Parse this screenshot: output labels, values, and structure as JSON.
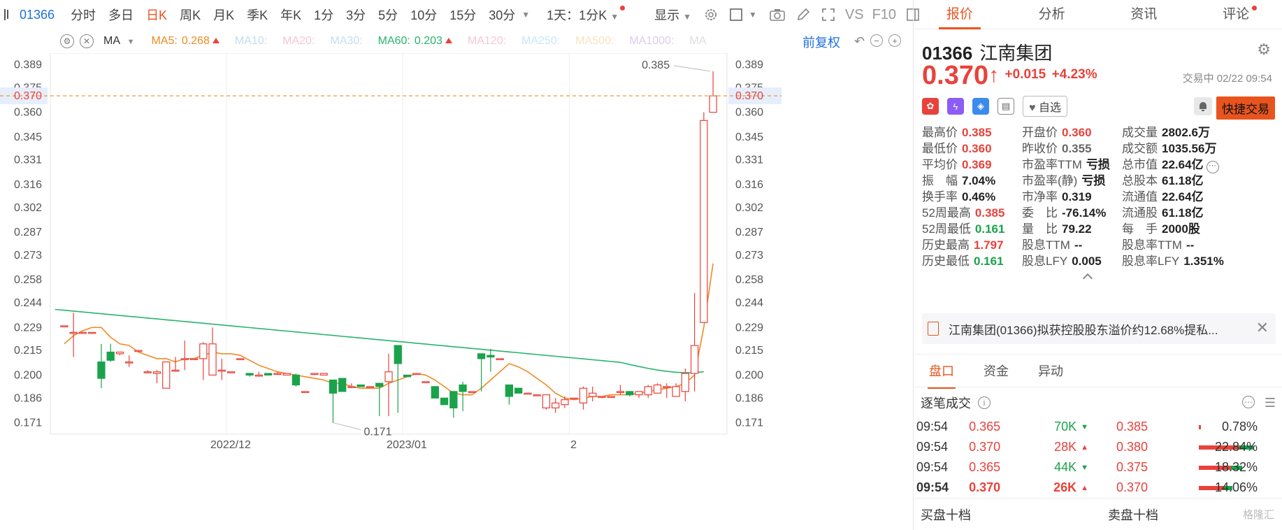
{
  "toolbar": {
    "code": "01366",
    "periods": [
      "分时",
      "多日",
      "日K",
      "周K",
      "月K",
      "季K",
      "年K",
      "1分",
      "3分",
      "5分",
      "10分",
      "15分",
      "30分"
    ],
    "active_period": "日K",
    "multi_select": "1天：1分K",
    "display": "显示",
    "vs": "VS",
    "f10": "F10"
  },
  "ma": {
    "selector": "MA",
    "items": [
      {
        "label": "MA5:",
        "value": "0.268",
        "color": "#f08a24",
        "arrow": true
      },
      {
        "label": "MA10:",
        "value": "",
        "color": "#c4dcf2",
        "arrow": false
      },
      {
        "label": "MA20:",
        "value": "",
        "color": "#f6c6d8",
        "arrow": false
      },
      {
        "label": "MA30:",
        "value": "",
        "color": "#c4dcf2",
        "arrow": false
      },
      {
        "label": "MA60:",
        "value": "0.203",
        "color": "#28b46e",
        "arrow": true
      },
      {
        "label": "MA120:",
        "value": "",
        "color": "#f6c6d8",
        "arrow": false
      },
      {
        "label": "MA250:",
        "value": "",
        "color": "#c8e8f6",
        "arrow": false
      },
      {
        "label": "MA500:",
        "value": "",
        "color": "#f7e2c0",
        "arrow": false
      },
      {
        "label": "MA1000:",
        "value": "",
        "color": "#dccbf0",
        "arrow": false
      },
      {
        "label": "MA",
        "value": "",
        "color": "#dddddd",
        "arrow": false
      }
    ],
    "adjust": "前复权"
  },
  "chart_data": {
    "type": "candlestick",
    "y_ticks": [
      "0.389",
      "0.375",
      "0.360",
      "0.345",
      "0.331",
      "0.316",
      "0.302",
      "0.287",
      "0.273",
      "0.258",
      "0.244",
      "0.229",
      "0.215",
      "0.200",
      "0.186",
      "0.171"
    ],
    "ylim": [
      0.164,
      0.396
    ],
    "x_labels": [
      {
        "label": "2022/12",
        "index": 18
      },
      {
        "label": "2023/01",
        "index": 37
      },
      {
        "label": "2",
        "index": 55
      }
    ],
    "current_price": "0.370",
    "max_label": "0.385",
    "min_label": "0.171",
    "candles": [
      [
        0.23,
        0.23,
        0.23,
        0.23
      ],
      [
        0.226,
        0.238,
        0.211,
        0.226
      ],
      [
        0.226,
        0.226,
        0.226,
        0.226
      ],
      [
        0.226,
        0.226,
        0.225,
        0.226
      ],
      [
        0.208,
        0.219,
        0.192,
        0.198
      ],
      [
        0.214,
        0.219,
        0.208,
        0.209
      ],
      [
        0.213,
        0.214,
        0.212,
        0.214
      ],
      [
        0.208,
        0.212,
        0.205,
        0.208
      ],
      [
        0.215,
        0.215,
        0.215,
        0.215
      ],
      [
        0.202,
        0.203,
        0.201,
        0.202
      ],
      [
        0.201,
        0.203,
        0.195,
        0.202
      ],
      [
        0.192,
        0.208,
        0.192,
        0.208
      ],
      [
        0.203,
        0.211,
        0.202,
        0.203
      ],
      [
        0.21,
        0.221,
        0.203,
        0.21
      ],
      [
        0.21,
        0.21,
        0.21,
        0.21
      ],
      [
        0.21,
        0.22,
        0.197,
        0.219
      ],
      [
        0.2,
        0.229,
        0.2,
        0.219
      ],
      [
        0.203,
        0.21,
        0.197,
        0.203
      ],
      [
        0.202,
        0.202,
        0.202,
        0.202
      ],
      [
        0.21,
        0.21,
        0.21,
        0.21
      ],
      [
        0.201,
        0.201,
        0.199,
        0.2
      ],
      [
        0.2,
        0.202,
        0.199,
        0.2
      ],
      [
        0.201,
        0.201,
        0.2,
        0.2
      ],
      [
        0.201,
        0.202,
        0.201,
        0.201
      ],
      [
        0.2,
        0.201,
        0.2,
        0.201
      ],
      [
        0.2,
        0.201,
        0.193,
        0.194
      ],
      [
        0.19,
        0.19,
        0.19,
        0.19
      ],
      [
        0.201,
        0.201,
        0.2,
        0.201
      ],
      [
        0.2,
        0.201,
        0.2,
        0.201
      ],
      [
        0.197,
        0.197,
        0.171,
        0.189
      ],
      [
        0.198,
        0.198,
        0.19,
        0.19
      ],
      [
        0.193,
        0.195,
        0.192,
        0.193
      ],
      [
        0.194,
        0.194,
        0.193,
        0.193
      ],
      [
        0.193,
        0.193,
        0.193,
        0.193
      ],
      [
        0.195,
        0.195,
        0.175,
        0.193
      ],
      [
        0.196,
        0.213,
        0.175,
        0.202
      ],
      [
        0.218,
        0.218,
        0.177,
        0.207
      ],
      [
        0.2,
        0.2,
        0.199,
        0.199
      ],
      [
        0.201,
        0.201,
        0.201,
        0.201
      ],
      [
        0.196,
        0.196,
        0.196,
        0.196
      ],
      [
        0.193,
        0.193,
        0.186,
        0.186
      ],
      [
        0.186,
        0.186,
        0.182,
        0.182
      ],
      [
        0.19,
        0.19,
        0.174,
        0.18
      ],
      [
        0.194,
        0.196,
        0.178,
        0.19
      ],
      [
        0.19,
        0.19,
        0.19,
        0.19
      ],
      [
        0.213,
        0.213,
        0.19,
        0.21
      ],
      [
        0.212,
        0.216,
        0.202,
        0.211
      ],
      [
        0.21,
        0.21,
        0.21,
        0.21
      ],
      [
        0.194,
        0.194,
        0.182,
        0.187
      ],
      [
        0.192,
        0.192,
        0.189,
        0.189
      ],
      [
        0.189,
        0.189,
        0.189,
        0.189
      ],
      [
        0.188,
        0.188,
        0.188,
        0.188
      ],
      [
        0.18,
        0.188,
        0.179,
        0.188
      ],
      [
        0.18,
        0.186,
        0.177,
        0.183
      ],
      [
        0.182,
        0.187,
        0.18,
        0.185
      ],
      [
        0.186,
        0.186,
        0.186,
        0.186
      ],
      [
        0.183,
        0.193,
        0.179,
        0.192
      ],
      [
        0.187,
        0.193,
        0.184,
        0.189
      ],
      [
        0.187,
        0.187,
        0.186,
        0.187
      ],
      [
        0.187,
        0.187,
        0.187,
        0.187
      ],
      [
        0.19,
        0.194,
        0.188,
        0.19
      ],
      [
        0.19,
        0.19,
        0.187,
        0.188
      ],
      [
        0.188,
        0.19,
        0.186,
        0.19
      ],
      [
        0.188,
        0.194,
        0.186,
        0.193
      ],
      [
        0.189,
        0.195,
        0.189,
        0.194
      ],
      [
        0.193,
        0.195,
        0.186,
        0.193
      ],
      [
        0.187,
        0.195,
        0.187,
        0.193
      ],
      [
        0.19,
        0.204,
        0.184,
        0.201
      ],
      [
        0.201,
        0.25,
        0.19,
        0.218
      ],
      [
        0.232,
        0.36,
        0.232,
        0.355
      ],
      [
        0.36,
        0.385,
        0.36,
        0.37
      ]
    ],
    "ma5": [
      0.219,
      0.224,
      0.227,
      0.229,
      0.229,
      0.223,
      0.219,
      0.218,
      0.214,
      0.212,
      0.21,
      0.21,
      0.208,
      0.21,
      0.21,
      0.212,
      0.214,
      0.213,
      0.213,
      0.212,
      0.209,
      0.206,
      0.204,
      0.202,
      0.201,
      0.2,
      0.199,
      0.198,
      0.197,
      0.195,
      0.195,
      0.193,
      0.192,
      0.192,
      0.192,
      0.195,
      0.197,
      0.199,
      0.201,
      0.2,
      0.197,
      0.193,
      0.189,
      0.188,
      0.188,
      0.192,
      0.197,
      0.202,
      0.207,
      0.205,
      0.202,
      0.198,
      0.194,
      0.189,
      0.186,
      0.185,
      0.186,
      0.187,
      0.187,
      0.188,
      0.188,
      0.188,
      0.189,
      0.19,
      0.191,
      0.192,
      0.193,
      0.195,
      0.2,
      0.229,
      0.268
    ],
    "ma60_start": 0.24,
    "ma60_end": 0.203
  },
  "panel": {
    "tabs": [
      "报价",
      "分析",
      "资讯",
      "评论"
    ],
    "active_tab": "报价",
    "code": "01366",
    "name": "江南集团",
    "price": "0.370",
    "change": "+0.015",
    "change_pct": "+4.23%",
    "status": "交易中 02/22 09:54",
    "watch_label": "自选",
    "quick_trade": "快捷交易",
    "stats": [
      {
        "label": "最高价",
        "value": "0.385",
        "tone": "red"
      },
      {
        "label": "开盘价",
        "value": "0.360",
        "tone": "red"
      },
      {
        "label": "成交量",
        "value": "2802.6万",
        "tone": "dark"
      },
      {
        "label": "最低价",
        "value": "0.360",
        "tone": "red"
      },
      {
        "label": "昨收价",
        "value": "0.355",
        "tone": "gray"
      },
      {
        "label": "成交额",
        "value": "1035.56万",
        "tone": "dark"
      },
      {
        "label": "平均价",
        "value": "0.369",
        "tone": "red"
      },
      {
        "label": "市盈率TTM",
        "value": "亏损",
        "tone": "dark"
      },
      {
        "label": "总市值",
        "value": "22.64亿",
        "tone": "dark"
      },
      {
        "label": "振　幅",
        "value": "7.04%",
        "tone": "dark"
      },
      {
        "label": "市盈率(静)",
        "value": "亏损",
        "tone": "dark"
      },
      {
        "label": "总股本",
        "value": "61.18亿",
        "tone": "dark"
      },
      {
        "label": "换手率",
        "value": "0.46%",
        "tone": "dark"
      },
      {
        "label": "市净率",
        "value": "0.319",
        "tone": "dark"
      },
      {
        "label": "流通值",
        "value": "22.64亿",
        "tone": "dark"
      },
      {
        "label": "52周最高",
        "value": "0.385",
        "tone": "red"
      },
      {
        "label": "委　比",
        "value": "-76.14%",
        "tone": "dark"
      },
      {
        "label": "流通股",
        "value": "61.18亿",
        "tone": "dark"
      },
      {
        "label": "52周最低",
        "value": "0.161",
        "tone": "green"
      },
      {
        "label": "量　比",
        "value": "79.22",
        "tone": "dark"
      },
      {
        "label": "每　手",
        "value": "2000股",
        "tone": "dark"
      },
      {
        "label": "历史最高",
        "value": "1.797",
        "tone": "red"
      },
      {
        "label": "股息TTM",
        "value": "--",
        "tone": "dark"
      },
      {
        "label": "股息率TTM",
        "value": "--",
        "tone": "dark"
      },
      {
        "label": "历史最低",
        "value": "0.161",
        "tone": "green"
      },
      {
        "label": "股息LFY",
        "value": "0.005",
        "tone": "dark"
      },
      {
        "label": "股息率LFY",
        "value": "1.351%",
        "tone": "dark"
      }
    ],
    "news": "江南集团(01366)拟获控股股东溢价约12.68%提私...",
    "sub_tabs": [
      "盘口",
      "资金",
      "异动"
    ],
    "trades_title": "逐笔成交",
    "trades": [
      {
        "time": "09:54",
        "price": "0.365",
        "vol": "70K",
        "dir": "down"
      },
      {
        "time": "09:54",
        "price": "0.370",
        "vol": "28K",
        "dir": "up"
      },
      {
        "time": "09:54",
        "price": "0.365",
        "vol": "44K",
        "dir": "down"
      },
      {
        "time": "09:54",
        "price": "0.370",
        "vol": "26K",
        "dir": "up"
      }
    ],
    "depth": [
      {
        "price": "0.385",
        "pct": "0.78%",
        "share": 0.0078
      },
      {
        "price": "0.380",
        "pct": "22.84%",
        "share": 0.2284
      },
      {
        "price": "0.375",
        "pct": "18.32%",
        "share": 0.1832
      },
      {
        "price": "0.370",
        "pct": "14.06%",
        "share": 0.1406
      }
    ],
    "buy10": "买盘十档",
    "sell10": "卖盘十档",
    "watermark": "格隆汇"
  }
}
